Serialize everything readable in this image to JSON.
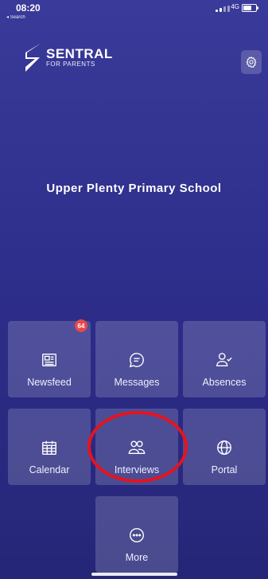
{
  "status": {
    "time": "08:20",
    "back": "◂ Search",
    "network": "4G"
  },
  "logo": {
    "brand": "SENTRAL",
    "sub": "FOR PARENTS"
  },
  "school": "Upper Plenty Primary School",
  "tiles": {
    "newsfeed": {
      "label": "Newsfeed",
      "badge": "64",
      "icon": "newspaper-icon"
    },
    "messages": {
      "label": "Messages",
      "icon": "chat-bubble-icon"
    },
    "absences": {
      "label": "Absences",
      "icon": "person-check-icon"
    },
    "calendar": {
      "label": "Calendar",
      "icon": "calendar-icon"
    },
    "interviews": {
      "label": "Interviews",
      "icon": "people-icon"
    },
    "portal": {
      "label": "Portal",
      "icon": "globe-icon"
    },
    "more": {
      "label": "More",
      "icon": "ellipsis-circle-icon"
    }
  },
  "colors": {
    "background": "#2e2e8c",
    "badge": "#e5484d",
    "highlight": "#e4141d"
  }
}
